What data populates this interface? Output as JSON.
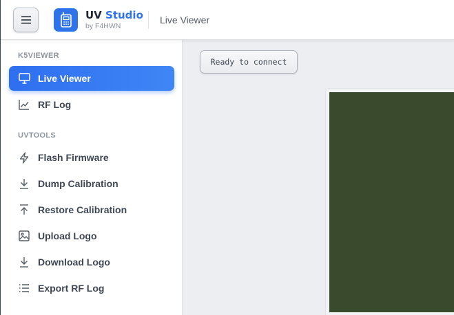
{
  "header": {
    "brand_name": "UV",
    "brand_accent": "Studio",
    "brand_sub": "by F4HWN",
    "page_title": "Live Viewer",
    "accent_color": "#2f73ea"
  },
  "sidebar": {
    "sections": [
      {
        "label": "K5VIEWER",
        "items": [
          {
            "label": "Live Viewer",
            "icon": "monitor-icon",
            "active": true
          },
          {
            "label": "RF Log",
            "icon": "line-chart-icon",
            "active": false
          }
        ]
      },
      {
        "label": "UVTOOLS",
        "items": [
          {
            "label": "Flash Firmware",
            "icon": "lightning-icon"
          },
          {
            "label": "Dump Calibration",
            "icon": "download-icon"
          },
          {
            "label": "Restore Calibration",
            "icon": "upload-icon"
          },
          {
            "label": "Upload Logo",
            "icon": "image-icon"
          },
          {
            "label": "Download Logo",
            "icon": "download-icon"
          },
          {
            "label": "Export RF Log",
            "icon": "list-icon"
          }
        ]
      }
    ]
  },
  "main": {
    "status_text": "Ready to connect",
    "screen_color": "#394a2d"
  }
}
